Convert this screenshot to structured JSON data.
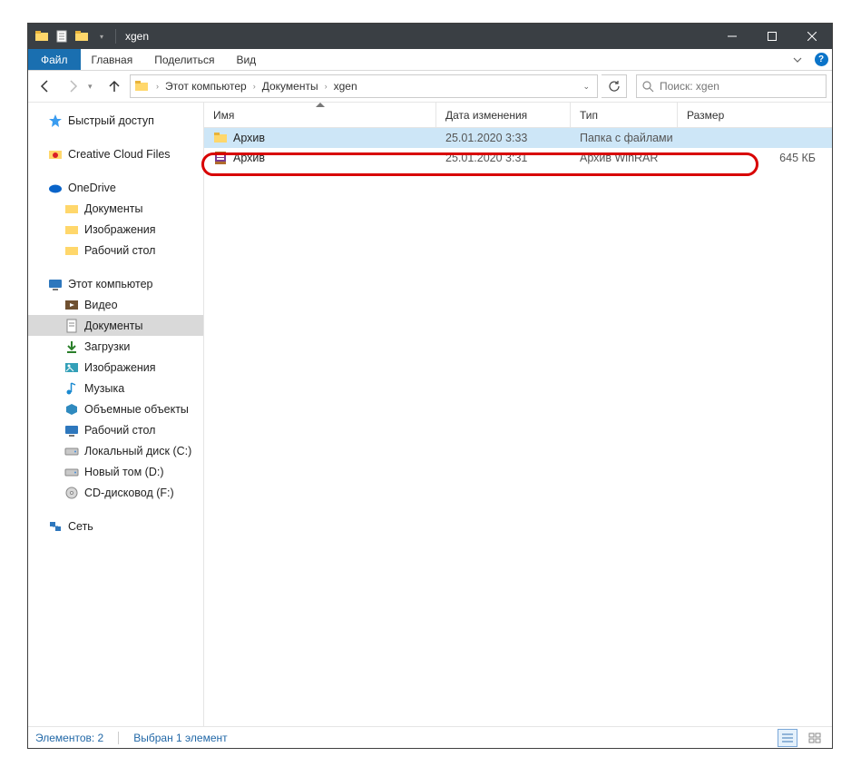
{
  "window": {
    "title": "xgen"
  },
  "ribbon": {
    "file": "Файл",
    "tabs": [
      "Главная",
      "Поделиться",
      "Вид"
    ]
  },
  "breadcrumbs": {
    "items": [
      "Этот компьютер",
      "Документы",
      "xgen"
    ]
  },
  "search": {
    "placeholder": "Поиск: xgen"
  },
  "sidebar": {
    "quick_access": "Быстрый доступ",
    "creative_cloud": "Creative Cloud Files",
    "onedrive": "OneDrive",
    "onedrive_children": [
      "Документы",
      "Изображения",
      "Рабочий стол"
    ],
    "this_pc": "Этот компьютер",
    "this_pc_children": [
      "Видео",
      "Документы",
      "Загрузки",
      "Изображения",
      "Музыка",
      "Объемные объекты",
      "Рабочий стол",
      "Локальный диск (C:)",
      "Новый том (D:)",
      "CD-дисковод (F:)"
    ],
    "network": "Сеть"
  },
  "columns": {
    "name": "Имя",
    "date": "Дата изменения",
    "type": "Тип",
    "size": "Размер"
  },
  "rows": [
    {
      "name": "Архив",
      "date": "25.01.2020 3:33",
      "type": "Папка с файлами",
      "size": "",
      "icon": "folder",
      "selected": true
    },
    {
      "name": "Архив",
      "date": "25.01.2020 3:31",
      "type": "Архив WinRAR",
      "size": "645 КБ",
      "icon": "rar",
      "selected": false
    }
  ],
  "status": {
    "items": "Элементов: 2",
    "selection": "Выбран 1 элемент"
  }
}
